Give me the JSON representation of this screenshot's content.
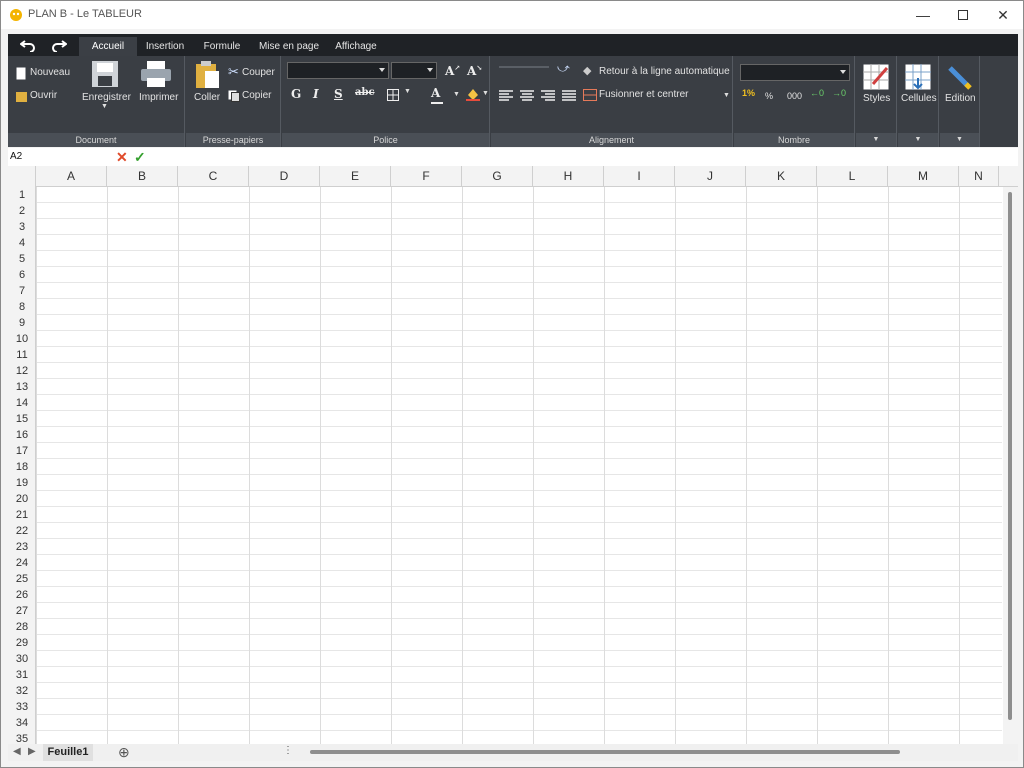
{
  "window": {
    "title": "PLAN B - Le TABLEUR",
    "min_icon": "minimize-icon",
    "max_icon": "maximize-icon",
    "close_icon": "close-icon"
  },
  "tabs": [
    "Accueil",
    "Insertion",
    "Formule",
    "Mise en page",
    "Affichage"
  ],
  "active_tab": "Accueil",
  "groups": {
    "document": {
      "label": "Document",
      "nouveau": "Nouveau",
      "ouvrir": "Ouvrir",
      "enregistrer": "Enregistrer",
      "imprimer": "Imprimer"
    },
    "presse": {
      "label": "Presse-papiers",
      "coller": "Coller",
      "couper": "Couper",
      "copier": "Copier"
    },
    "police": {
      "label": "Police",
      "font_name": "",
      "font_size": ""
    },
    "alignement": {
      "label": "Alignement",
      "wrap": "Retour à la ligne automatique",
      "merge": "Fusionner et centrer"
    },
    "nombre": {
      "label": "Nombre",
      "format": "",
      "percent": "%",
      "thousands": "000"
    },
    "styles": "Styles",
    "cellules": "Cellules",
    "edition": "Edition"
  },
  "formula_bar": {
    "cell_ref": "A2",
    "value": ""
  },
  "columns": [
    "A",
    "B",
    "C",
    "D",
    "E",
    "F",
    "G",
    "H",
    "I",
    "J",
    "K",
    "L",
    "M",
    "N"
  ],
  "rows": [
    "1",
    "2",
    "3",
    "4",
    "5",
    "6",
    "7",
    "8",
    "9",
    "10",
    "11",
    "12",
    "13",
    "14",
    "15",
    "16",
    "17",
    "18",
    "19",
    "20",
    "21",
    "22",
    "23",
    "24",
    "25",
    "26",
    "27",
    "28",
    "29",
    "30",
    "31",
    "32",
    "33",
    "34",
    "35"
  ],
  "sheet_tabs": [
    "Feuille1"
  ],
  "colors": {
    "ribbon": "#3a3e44",
    "cancel": "#e04a2a",
    "confirm": "#35a02e"
  }
}
